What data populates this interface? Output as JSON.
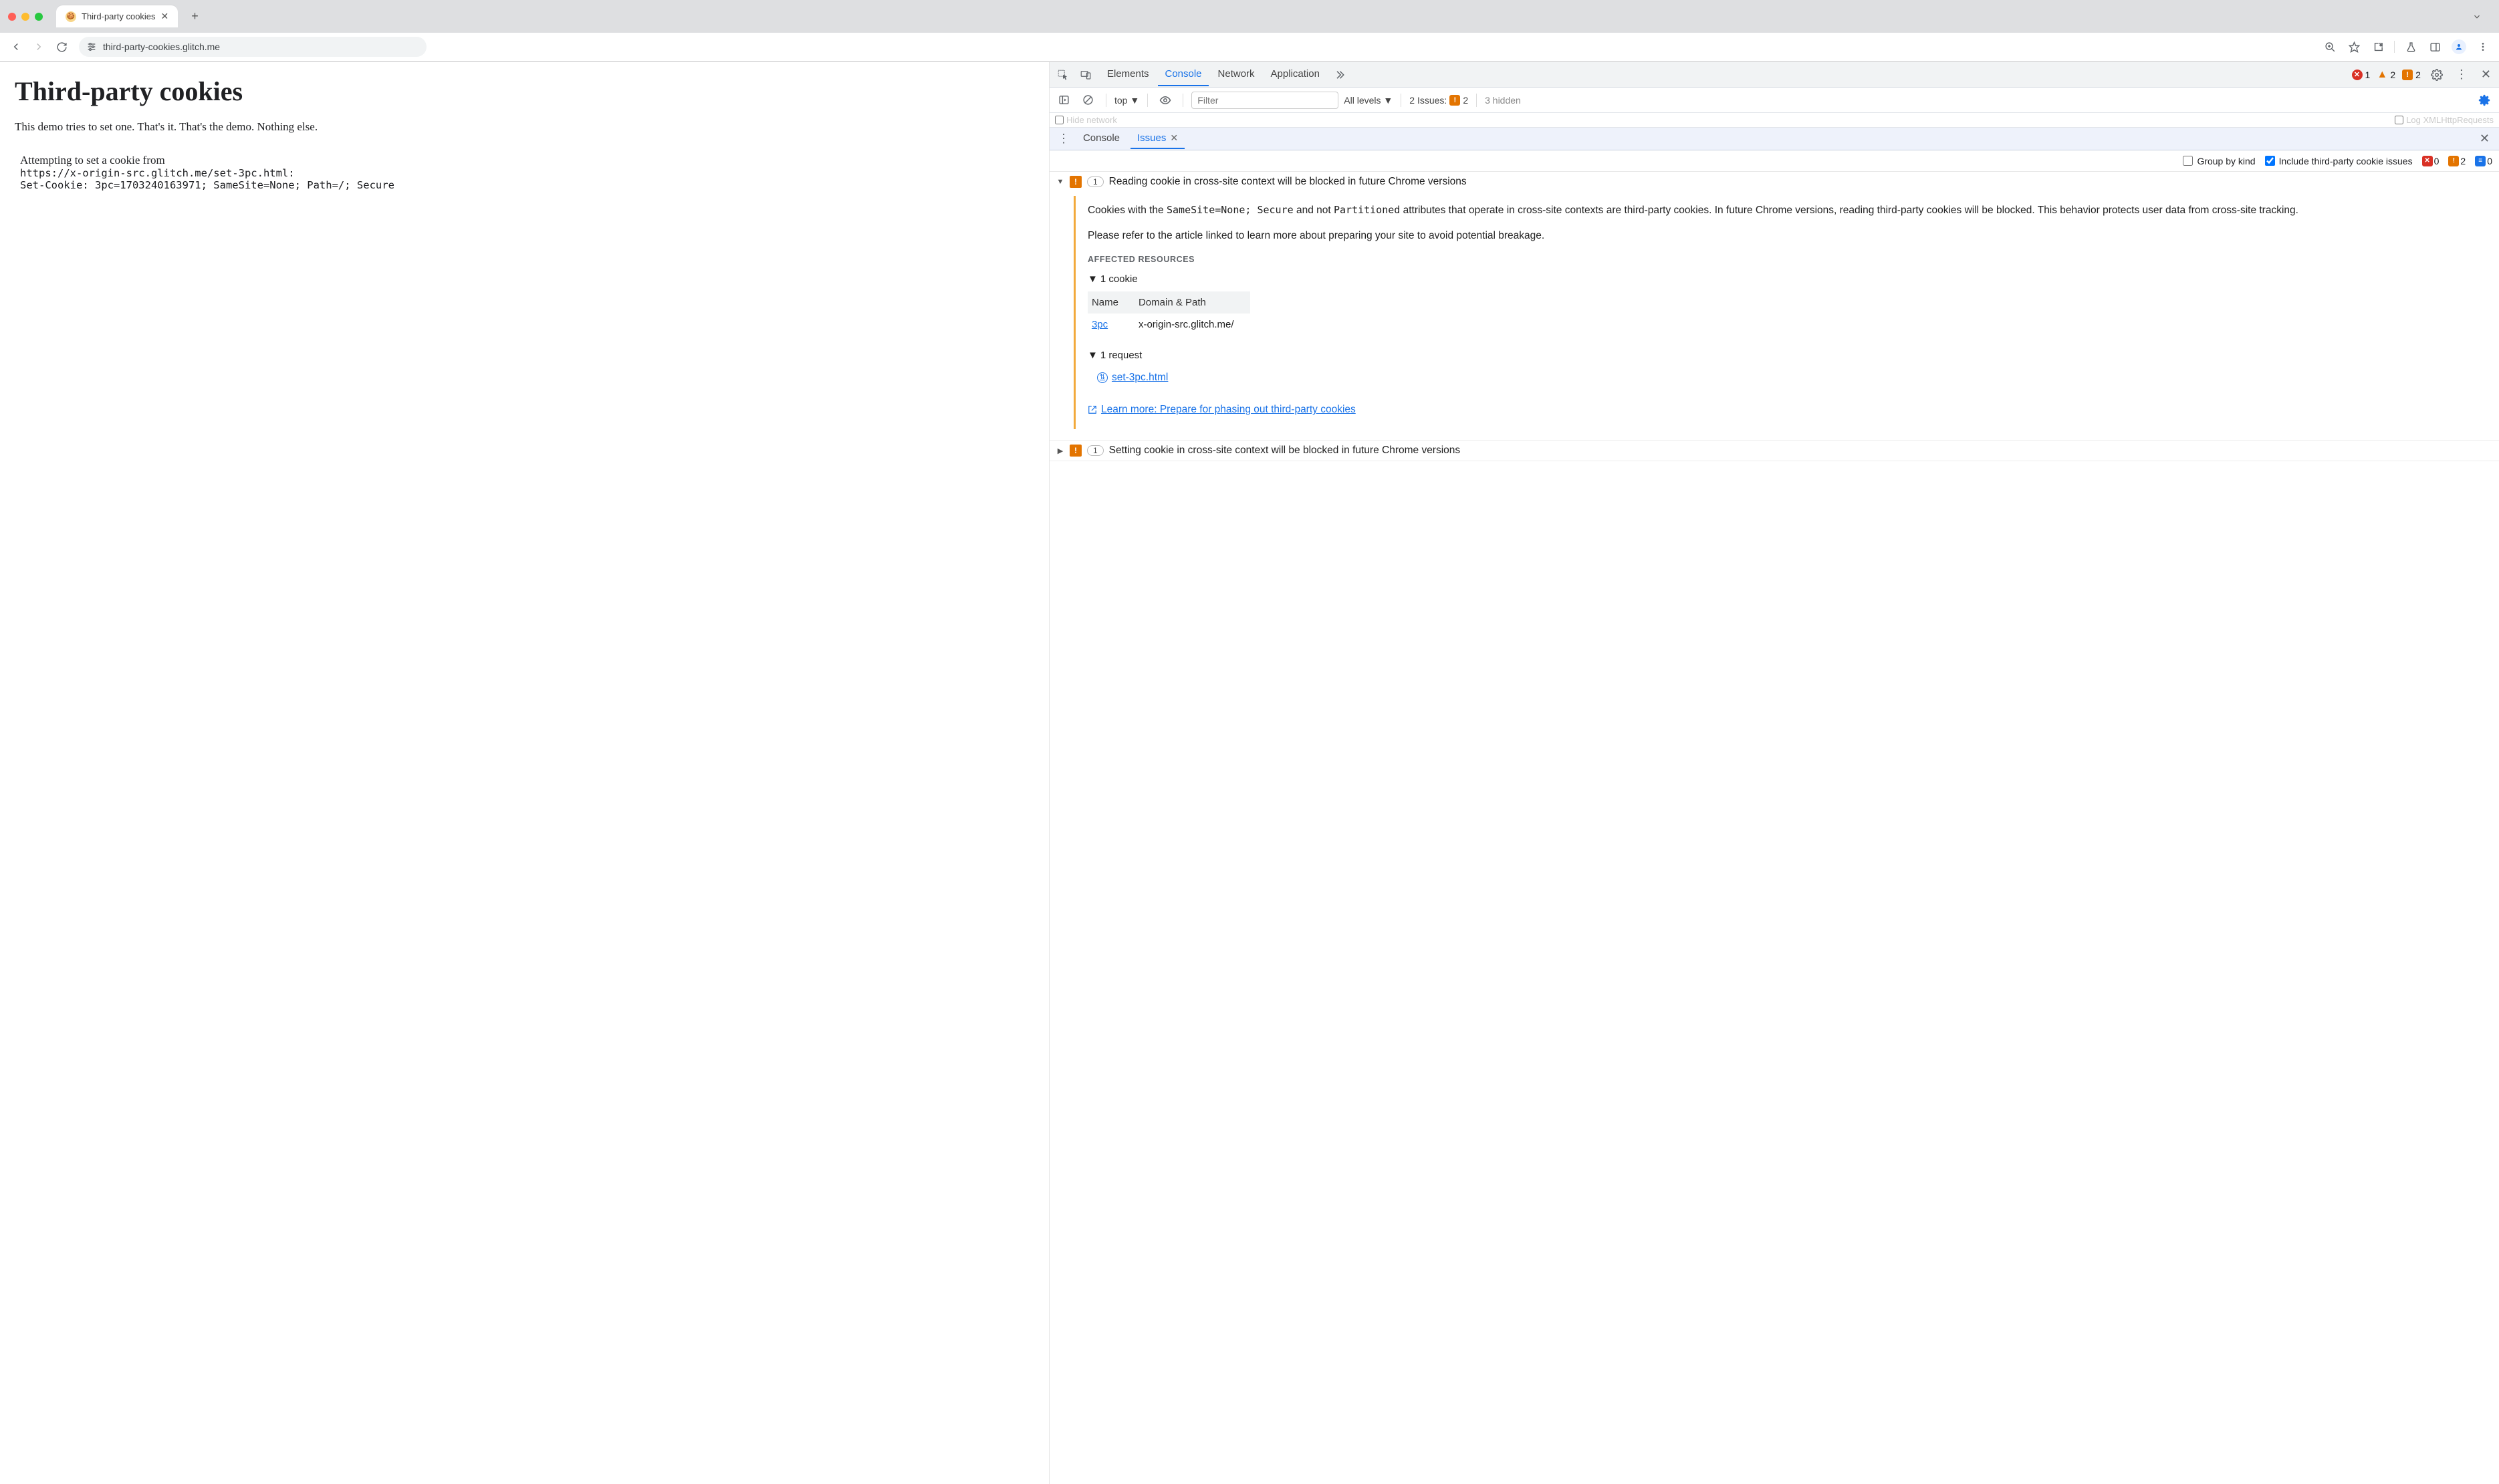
{
  "browser": {
    "tab_title": "Third-party cookies",
    "url": "third-party-cookies.glitch.me"
  },
  "page": {
    "heading": "Third-party cookies",
    "intro": "This demo tries to set one. That's it. That's the demo. Nothing else.",
    "attempt_line1": "Attempting to set a cookie from",
    "attempt_url": "https://x-origin-src.glitch.me/set-3pc.html",
    "attempt_header": "Set-Cookie: 3pc=1703240163971; SameSite=None; Path=/; Secure"
  },
  "devtools": {
    "tabs": {
      "elements": "Elements",
      "console": "Console",
      "network": "Network",
      "application": "Application"
    },
    "status": {
      "errors": "1",
      "warnings": "2",
      "breaking": "2"
    },
    "console_toolbar": {
      "context": "top",
      "filter_placeholder": "Filter",
      "levels": "All levels",
      "issues_label": "2 Issues:",
      "issues_count": "2",
      "hidden": "3 hidden"
    },
    "subbar": {
      "hide_network": "Hide network",
      "log_xhr": "Log XMLHttpRequests"
    },
    "drawer": {
      "console_tab": "Console",
      "issues_tab": "Issues"
    },
    "issues_toolbar": {
      "group_by_kind": "Group by kind",
      "include_3pc": "Include third-party cookie issues",
      "red_count": "0",
      "orange_count": "2",
      "blue_count": "0"
    },
    "issues": [
      {
        "count": "1",
        "title": "Reading cookie in cross-site context will be blocked in future Chrome versions",
        "expanded": true,
        "desc_p1_pre": "Cookies with the ",
        "desc_code1": "SameSite=None; Secure",
        "desc_p1_mid": " and not ",
        "desc_code2": "Partitioned",
        "desc_p1_post": " attributes that operate in cross-site contexts are third-party cookies. In future Chrome versions, reading third-party cookies will be blocked. This behavior protects user data from cross-site tracking.",
        "desc_p2": "Please refer to the article linked to learn more about preparing your site to avoid potential breakage.",
        "affected_heading": "AFFECTED RESOURCES",
        "cookies_label": "1 cookie",
        "table_col_name": "Name",
        "table_col_domain": "Domain & Path",
        "cookie_name": "3pc",
        "cookie_domain": "x-origin-src.glitch.me/",
        "requests_label": "1 request",
        "request_name": "set-3pc.html",
        "learn_more": "Learn more: Prepare for phasing out third-party cookies"
      },
      {
        "count": "1",
        "title": "Setting cookie in cross-site context will be blocked in future Chrome versions",
        "expanded": false
      }
    ]
  }
}
